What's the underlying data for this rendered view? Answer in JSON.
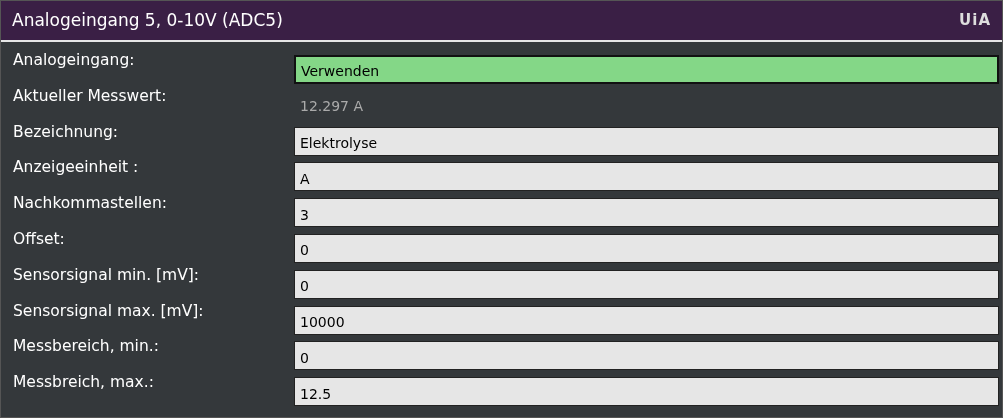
{
  "panel": {
    "title": "Analogeingang 5, 0-10V (ADC5)",
    "logo": "UiA"
  },
  "rows": [
    {
      "label": "Analogeingang:",
      "kind": "select",
      "value": "Verwenden"
    },
    {
      "label": "Aktueller Messwert:",
      "kind": "readout",
      "value": "12.297 A"
    },
    {
      "label": "Bezeichnung:",
      "kind": "input",
      "value": "Elektrolyse"
    },
    {
      "label": "Anzeigeeinheit :",
      "kind": "input",
      "value": "A"
    },
    {
      "label": "Nachkommastellen:",
      "kind": "input",
      "value": "3"
    },
    {
      "label": "Offset:",
      "kind": "input",
      "value": "0"
    },
    {
      "label": "Sensorsignal min. [mV]:",
      "kind": "input",
      "value": "0"
    },
    {
      "label": "Sensorsignal max. [mV]:",
      "kind": "input",
      "value": "10000"
    },
    {
      "label": "Messbereich, min.:",
      "kind": "input",
      "value": "0"
    },
    {
      "label": "Messbreich, max.:",
      "kind": "input",
      "value": "12.5"
    }
  ]
}
